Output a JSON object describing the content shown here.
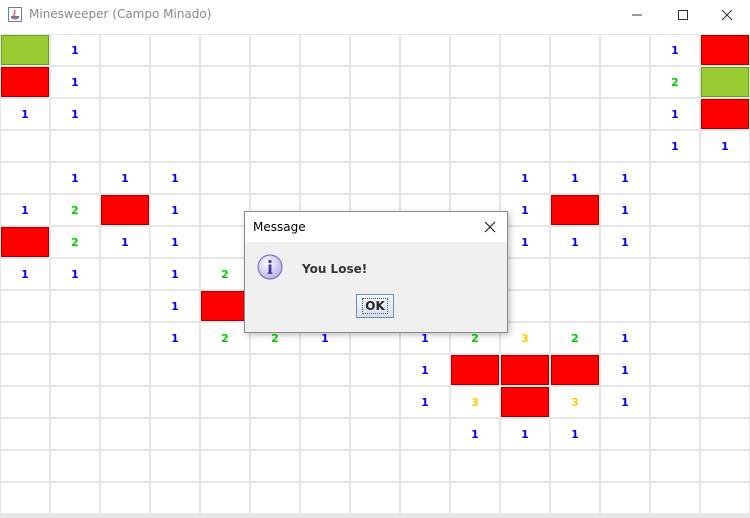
{
  "window": {
    "title": "Minesweeper (Campo Minado)",
    "controls": [
      "minimize",
      "maximize",
      "close"
    ]
  },
  "board": {
    "columns": 15,
    "rows": 15,
    "number_colors": {
      "1": "#0000ff",
      "2": "#00cc00",
      "3": "#ffcc00"
    },
    "mine_color": "#ff0000",
    "flag_color": "#99cc33",
    "cells": [
      [
        "F",
        "1",
        "",
        "",
        "",
        "",
        "",
        "",
        "",
        "",
        "",
        "",
        "",
        "1",
        "M"
      ],
      [
        "M",
        "1",
        "",
        "",
        "",
        "",
        "",
        "",
        "",
        "",
        "",
        "",
        "",
        "2",
        "F"
      ],
      [
        "1",
        "1",
        "",
        "",
        "",
        "",
        "",
        "",
        "",
        "",
        "",
        "",
        "",
        "1",
        "M"
      ],
      [
        "",
        "",
        "",
        "",
        "",
        "",
        "",
        "",
        "",
        "",
        "",
        "",
        "",
        "1",
        "1"
      ],
      [
        "",
        "1",
        "1",
        "1",
        "",
        "",
        "",
        "",
        "",
        "",
        "1",
        "1",
        "1",
        "",
        ""
      ],
      [
        "1",
        "2",
        "M",
        "1",
        "",
        "",
        "",
        "",
        "",
        "",
        "1",
        "M",
        "1",
        "",
        ""
      ],
      [
        "M",
        "2",
        "1",
        "1",
        "",
        "",
        "",
        "",
        "",
        "",
        "1",
        "1",
        "1",
        "",
        ""
      ],
      [
        "1",
        "1",
        "",
        "1",
        "2",
        "",
        "",
        "",
        "",
        "",
        "",
        "",
        "",
        "",
        ""
      ],
      [
        "",
        "",
        "",
        "1",
        "M",
        "",
        "",
        "",
        "",
        "",
        "",
        "",
        "",
        "",
        ""
      ],
      [
        "",
        "",
        "",
        "1",
        "2",
        "2",
        "1",
        "",
        "1",
        "2",
        "3",
        "2",
        "1",
        "",
        ""
      ],
      [
        "",
        "",
        "",
        "",
        "",
        "",
        "",
        "",
        "1",
        "M",
        "M",
        "M",
        "1",
        "",
        ""
      ],
      [
        "",
        "",
        "",
        "",
        "",
        "",
        "",
        "",
        "1",
        "3",
        "M",
        "3",
        "1",
        "",
        ""
      ],
      [
        "",
        "",
        "",
        "",
        "",
        "",
        "",
        "",
        "",
        "1",
        "1",
        "1",
        "",
        "",
        ""
      ],
      [
        "",
        "",
        "",
        "",
        "",
        "",
        "",
        "",
        "",
        "",
        "",
        "",
        "",
        "",
        ""
      ],
      [
        "",
        "",
        "",
        "",
        "",
        "",
        "",
        "",
        "",
        "",
        "",
        "",
        "",
        "",
        ""
      ]
    ]
  },
  "dialog": {
    "title": "Message",
    "icon": "info-icon",
    "message": "You Lose!",
    "ok_label": "OK"
  }
}
